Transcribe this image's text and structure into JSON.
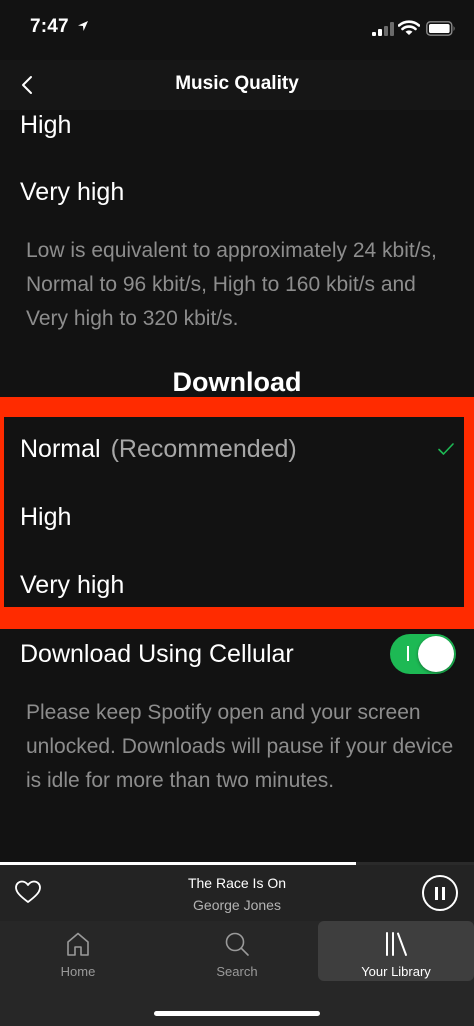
{
  "status_bar": {
    "time": "7:47"
  },
  "header": {
    "title": "Music Quality"
  },
  "streaming": {
    "options": [
      "High",
      "Very high"
    ],
    "hint": "Low is equivalent to approximately 24 kbit/s, Normal to 96 kbit/s, High to 160 kbit/s and Very high to 320 kbit/s."
  },
  "download": {
    "title": "Download",
    "options": [
      {
        "label": "Normal",
        "note": "(Recommended)",
        "selected": true
      },
      {
        "label": "High"
      },
      {
        "label": "Very high"
      }
    ],
    "highlight_color": "#ff2b00"
  },
  "cellular": {
    "label": "Download Using Cellular",
    "enabled": true,
    "hint": "Please keep Spotify open and your screen unlocked. Downloads will pause if your device is idle for more than two minutes."
  },
  "player": {
    "track_title": "The Race Is On",
    "artist": "George Jones",
    "progress": 0.75
  },
  "tabs": [
    {
      "label": "Home",
      "icon": "home-icon"
    },
    {
      "label": "Search",
      "icon": "search-icon"
    },
    {
      "label": "Your Library",
      "icon": "library-icon",
      "active": true
    }
  ],
  "colors": {
    "accent": "#1db954",
    "background": "#121212",
    "check": "#1db954"
  }
}
